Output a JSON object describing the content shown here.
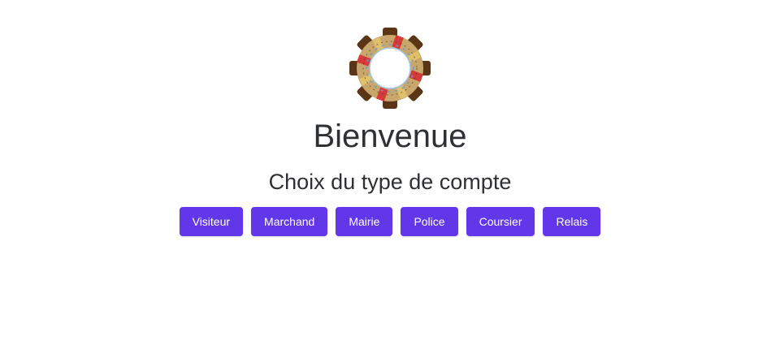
{
  "header": {
    "logo_icon": "circular-town-logo-icon",
    "title": "Bienvenue",
    "subtitle": "Choix du type de compte"
  },
  "account_types": [
    {
      "label": "Visiteur"
    },
    {
      "label": "Marchand"
    },
    {
      "label": "Mairie"
    },
    {
      "label": "Police"
    },
    {
      "label": "Coursier"
    },
    {
      "label": "Relais"
    }
  ],
  "colors": {
    "accent": "#6237ea",
    "text": "#2f3033",
    "background": "#ffffff"
  }
}
